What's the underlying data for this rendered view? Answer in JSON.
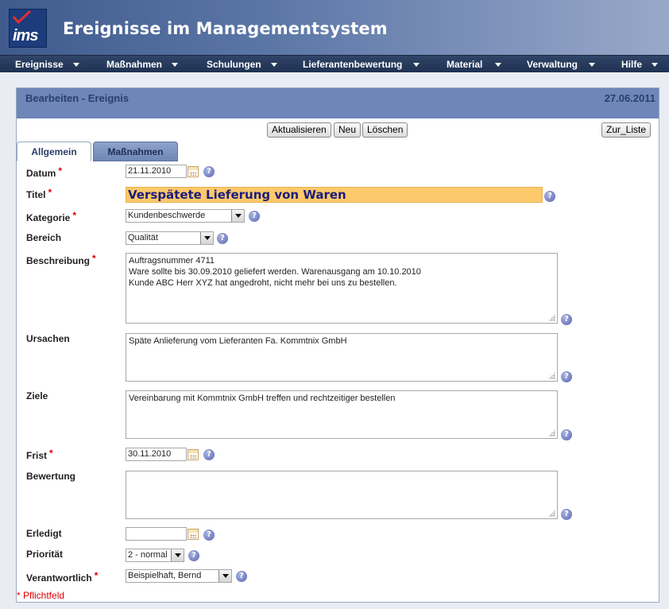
{
  "app": {
    "logo_text": "ims",
    "title": "Ereignisse im Managementsystem"
  },
  "menu": [
    {
      "label": "Ereignisse"
    },
    {
      "label": "Maßnahmen"
    },
    {
      "label": "Schulungen"
    },
    {
      "label": "Lieferantenbewertung"
    },
    {
      "label": "Material"
    },
    {
      "label": "Verwaltung"
    },
    {
      "label": "Hilfe"
    }
  ],
  "panel": {
    "title": "Bearbeiten - Ereignis",
    "date": "27.06.2011"
  },
  "buttons": {
    "update": "Aktualisieren",
    "new": "Neu",
    "delete": "Löschen",
    "to_list": "Zur_Liste"
  },
  "tabs": [
    {
      "label": "Allgemein",
      "active": true
    },
    {
      "label": "Maßnahmen",
      "active": false
    }
  ],
  "form": {
    "datum": {
      "label": "Datum",
      "required": "*",
      "value": "21.11.2010"
    },
    "titel": {
      "label": "Titel",
      "required": "*",
      "value": "Verspätete Lieferung von Waren"
    },
    "kategorie": {
      "label": "Kategorie",
      "required": "*",
      "value": "Kundenbeschwerde"
    },
    "bereich": {
      "label": "Bereich",
      "value": "Qualität"
    },
    "beschreibung": {
      "label": "Beschreibung",
      "required": "*",
      "lines": [
        "Auftragsnummer 4711",
        "Ware sollte bis 30.09.2010 geliefert werden. Warenausgang am 10.10.2010",
        "Kunde ABC Herr XYZ hat angedroht, nicht mehr bei uns zu bestellen."
      ]
    },
    "ursachen": {
      "label": "Ursachen",
      "value": "Späte Anlieferung vom Lieferanten Fa. Kommtnix GmbH"
    },
    "ziele": {
      "label": "Ziele",
      "value": "Vereinbarung mit Kommtnix GmbH treffen und rechtzeitiger bestellen"
    },
    "frist": {
      "label": "Frist",
      "required": "*",
      "value": "30.11.2010"
    },
    "bewertung": {
      "label": "Bewertung",
      "value": ""
    },
    "erledigt": {
      "label": "Erledigt",
      "value": ""
    },
    "prioritaet": {
      "label": "Priorität",
      "value": "2 - normal"
    },
    "verantwortlich": {
      "label": "Verantwortlich",
      "required": "*",
      "value": "Beispielhaft, Bernd"
    }
  },
  "help_glyph": "?",
  "footnote": "* Pflichtfeld",
  "icons": {
    "help": "help-icon",
    "calendar": "calendar-icon",
    "dropdown": "chevron-down-icon",
    "resize": "resize-grip-icon"
  },
  "colors": {
    "header": "#4f6a9c",
    "menubar": "#253a5c",
    "panel_header": "#6e86b8",
    "title_highlight": "#fcc96b",
    "required": "#dd0000"
  }
}
